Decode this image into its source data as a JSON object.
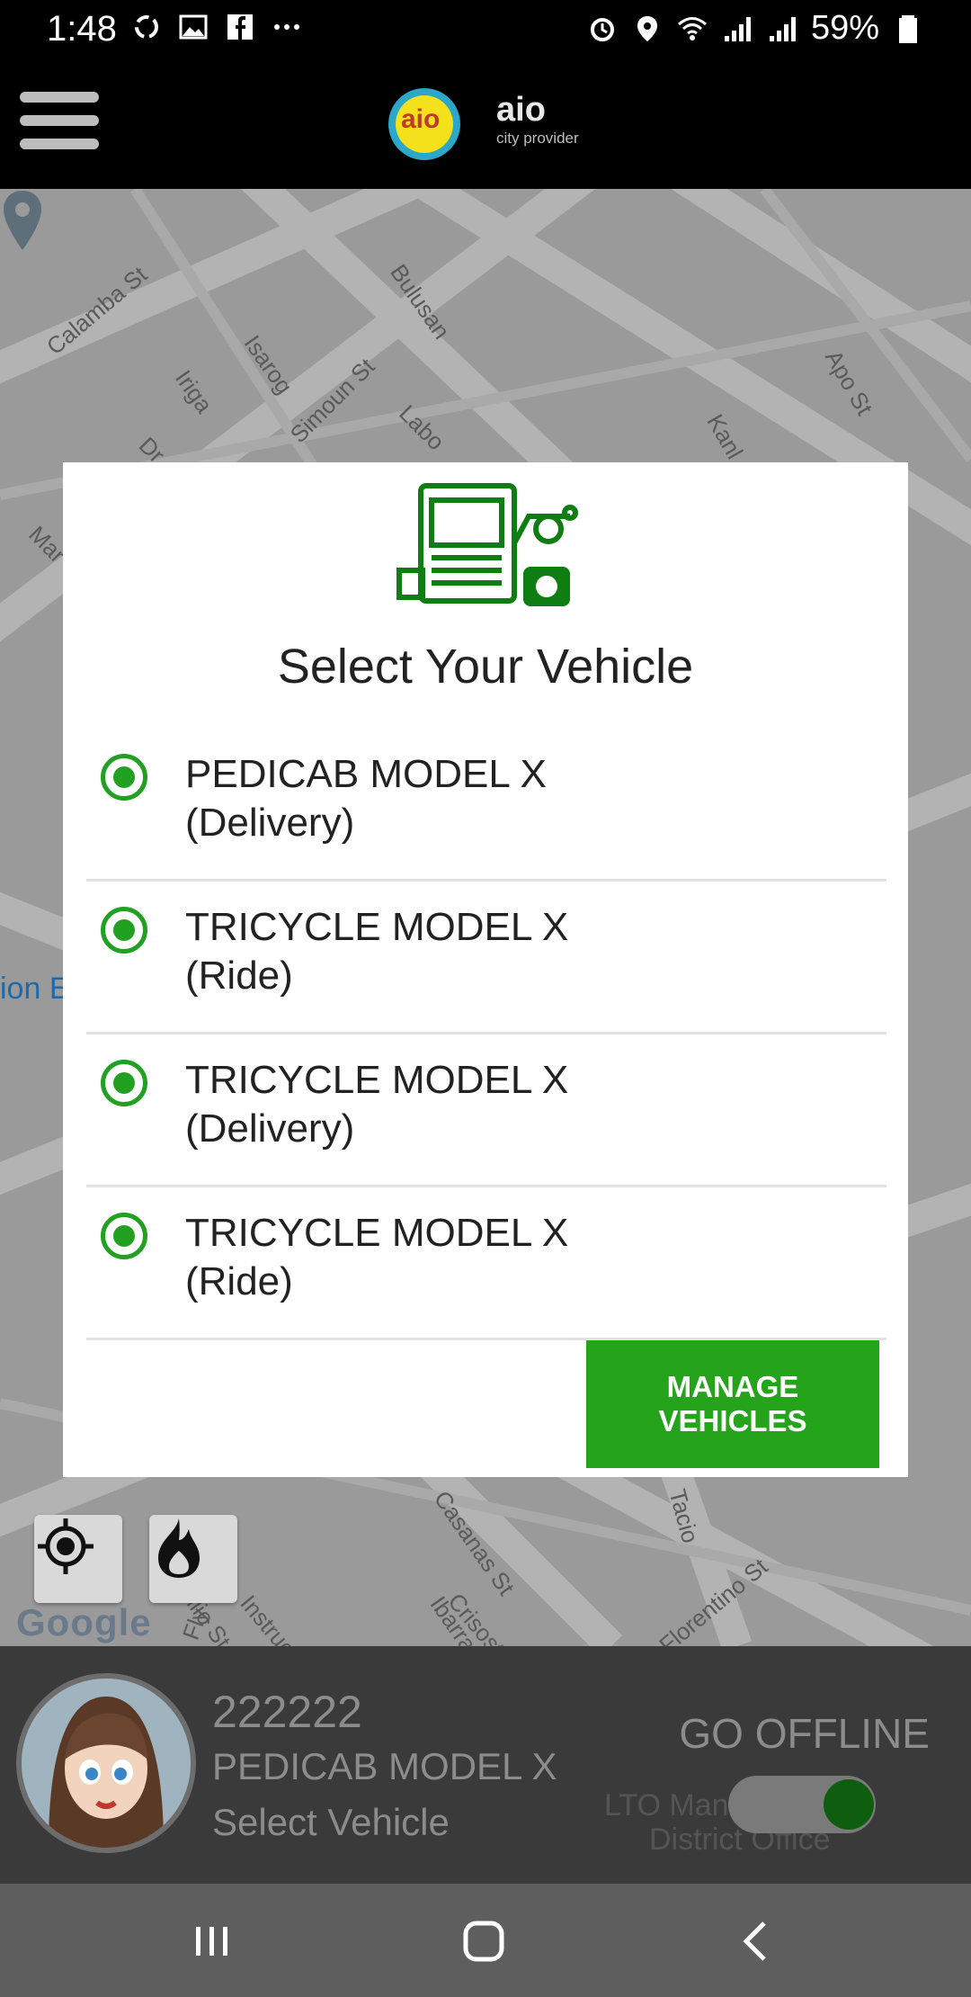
{
  "status_bar": {
    "time": "1:48",
    "battery": "59%",
    "left_icons": [
      "sync-icon",
      "gallery-icon",
      "facebook-icon",
      "more-icon"
    ],
    "right_icons": [
      "alarm-icon",
      "location-icon",
      "wifi-icon",
      "signal-icon",
      "signal-icon",
      "battery-icon"
    ]
  },
  "header": {
    "logo_text": "aio",
    "logo_badge": "aio",
    "subtitle": "city provider"
  },
  "map": {
    "street_labels": [
      "Calamba St",
      "Bulusan",
      "Isarog",
      "Iriga",
      "Simoun St",
      "Labo",
      "Apo St",
      "Kanl",
      "Dr",
      "Mar",
      "ion E",
      "Casanas St",
      "Crisostomo",
      "Tacio",
      "Florentino St",
      "Ibarra",
      "Basilio St",
      "Instruccion",
      "Fly"
    ],
    "google_logo": "Google"
  },
  "dialog": {
    "title": "Select Your Vehicle",
    "vehicles": [
      {
        "name": "PEDICAB MODEL X",
        "type": "(Delivery)"
      },
      {
        "name": "TRICYCLE MODEL X",
        "type": "(Ride)"
      },
      {
        "name": "TRICYCLE MODEL X",
        "type": "(Delivery)"
      },
      {
        "name": "TRICYCLE MODEL X",
        "type": "(Ride)"
      }
    ],
    "manage_button": "MANAGE VEHICLES"
  },
  "driver_panel": {
    "id": "222222",
    "vehicle": "PEDICAB MODEL X",
    "select_label": "Select Vehicle",
    "status_label": "GO OFFLINE",
    "map_place_line1": "LTO Man",
    "map_place_line2": "District Office"
  },
  "colors": {
    "accent_green": "#24a31b",
    "dialog_bg": "#ffffff",
    "header_bg": "#000000"
  }
}
